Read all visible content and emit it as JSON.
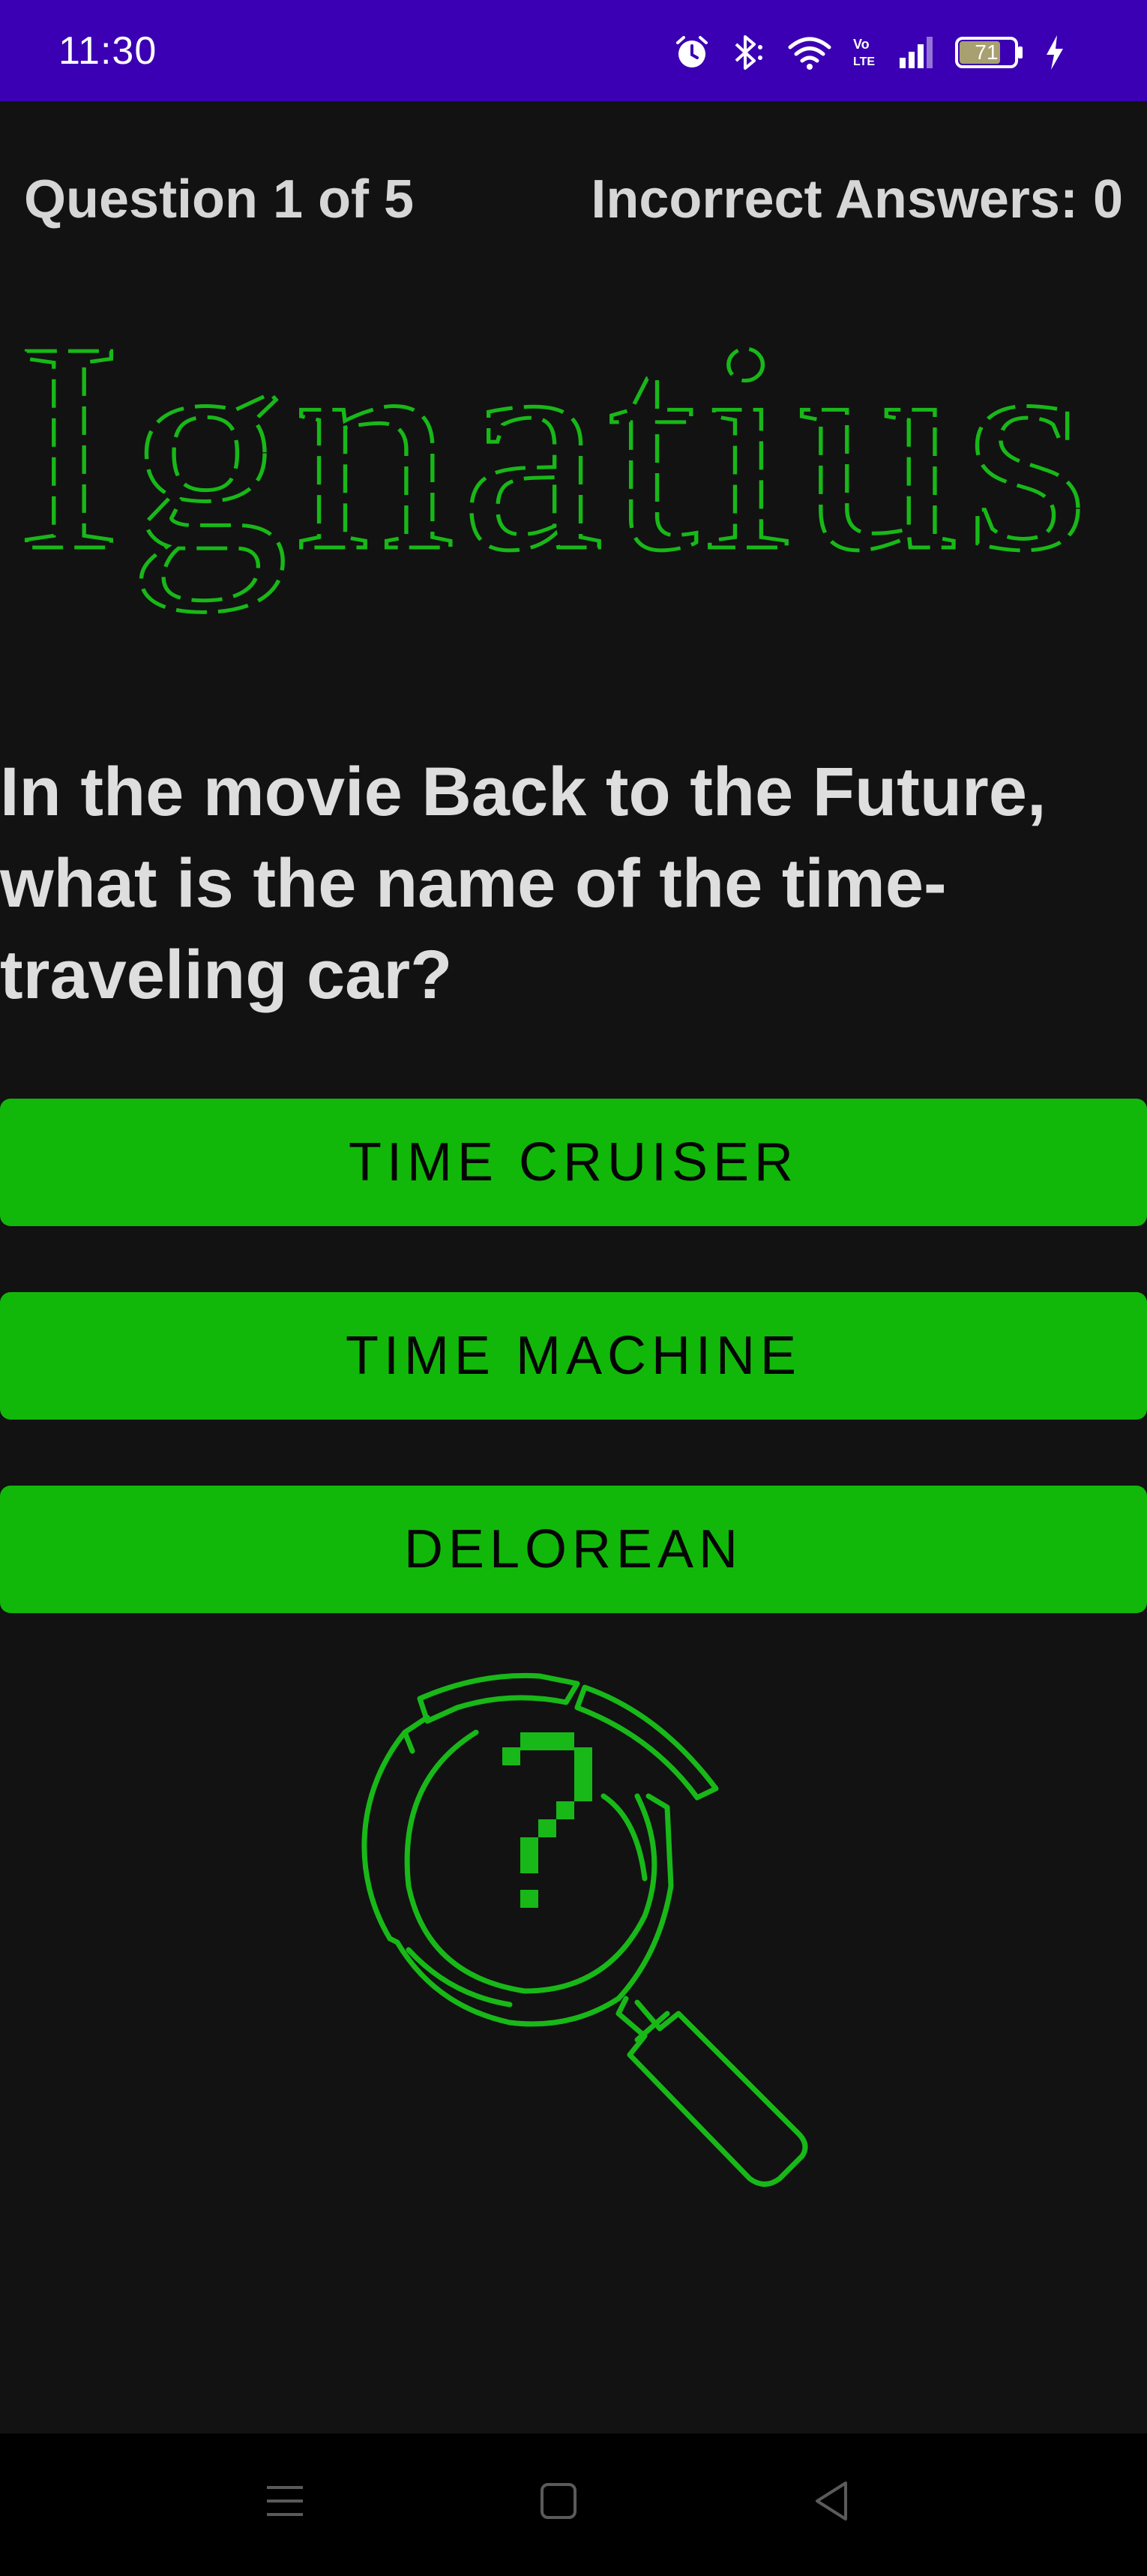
{
  "status_bar": {
    "time": "11:30",
    "battery": "71",
    "icons": [
      "alarm-icon",
      "bluetooth-icon",
      "wifi-icon",
      "volte-icon",
      "signal-icon",
      "battery-icon",
      "charging-icon"
    ]
  },
  "quiz": {
    "question_counter": "Question 1 of 5",
    "incorrect_counter": "Incorrect Answers: 0",
    "logo_text": "Ignatius",
    "question": "In the movie Back to the Future, what is the name of the time-traveling car?",
    "answers": [
      "TIME CRUISER",
      "TIME MACHINE",
      "DELOREAN"
    ]
  },
  "colors": {
    "status_bar": "#3b00b3",
    "background": "#121212",
    "accent_green": "#11b80a",
    "text_light": "#dedede"
  },
  "nav_bar": {
    "icons": [
      "recents-icon",
      "home-icon",
      "back-icon"
    ]
  }
}
